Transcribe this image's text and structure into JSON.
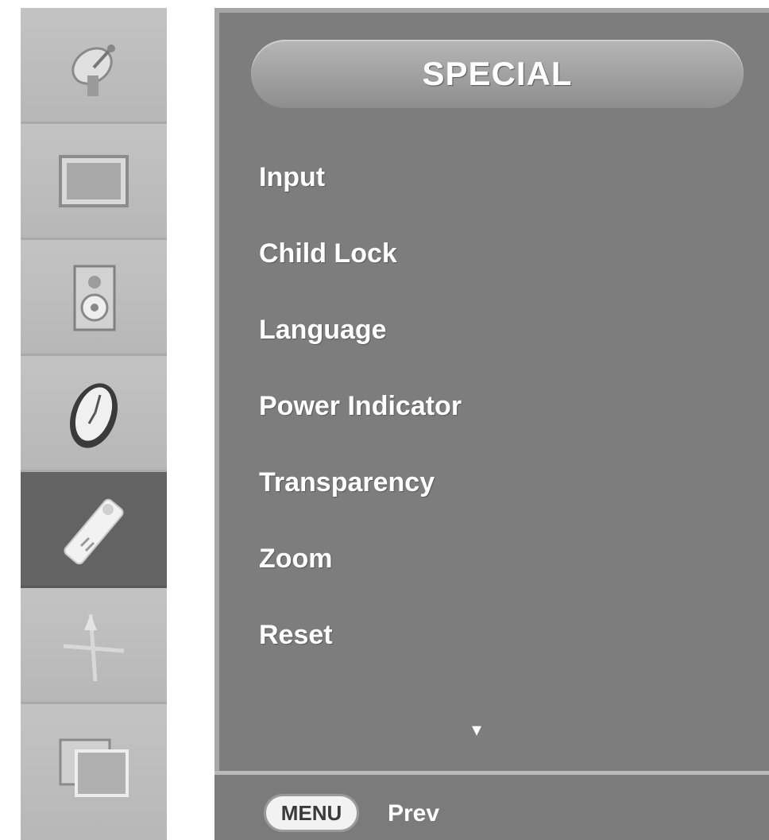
{
  "sidebar": {
    "items": [
      {
        "icon": "satellite-dish-icon"
      },
      {
        "icon": "picture-screen-icon"
      },
      {
        "icon": "speaker-icon"
      },
      {
        "icon": "clock-icon"
      },
      {
        "icon": "remote-control-icon",
        "active": true
      },
      {
        "icon": "cursor-crosshair-icon"
      },
      {
        "icon": "pip-screen-icon"
      }
    ]
  },
  "menu": {
    "title": "SPECIAL",
    "items": [
      "Input",
      "Child Lock",
      "Language",
      "Power Indicator",
      "Transparency",
      "Zoom",
      "Reset"
    ],
    "more_indicator": "▾"
  },
  "footer": {
    "button_label": "MENU",
    "hint_text": "Prev"
  },
  "colors": {
    "panel": "#7d7d7d",
    "sidebar": "#bdbdbd",
    "sidebar_active": "#636363",
    "text": "#ffffff"
  }
}
